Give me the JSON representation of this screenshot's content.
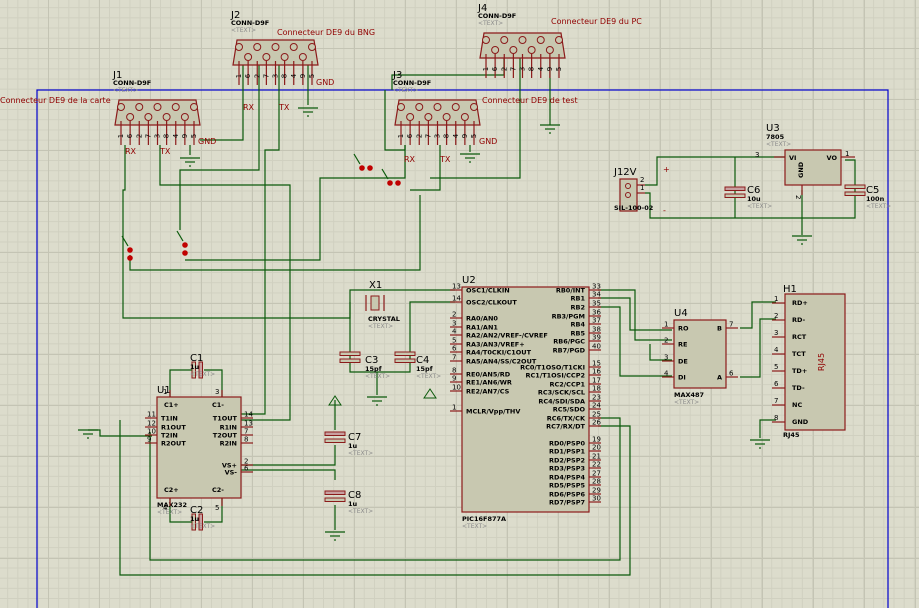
{
  "colors": {
    "wire": "#0b5a0b",
    "component_border": "#8b1a1a",
    "component_fill": "#c8c8b0",
    "sheet_border": "#0000cc",
    "label": "#900000",
    "background": "#dcdccc"
  },
  "placeholder": "<TEXT>",
  "connectors": {
    "J1": {
      "ref": "J1",
      "value": "CONN-D9F",
      "label": "Connecteur DE9 de la carte",
      "rx": "RX",
      "tx": "TX",
      "gnd": "GND"
    },
    "J2": {
      "ref": "J2",
      "value": "CONN-D9F",
      "label": "Connecteur DE9 du BNG",
      "rx": "RX",
      "tx": "TX",
      "gnd": "GND"
    },
    "J3": {
      "ref": "J3",
      "value": "CONN-D9F",
      "label": "Connecteur DE9 de test",
      "rx": "RX",
      "tx": "TX",
      "gnd": "GND"
    },
    "J4": {
      "ref": "J4",
      "value": "CONN-D9F",
      "label": "Connecteur DE9 du PC"
    },
    "db9_pins": [
      "1",
      "6",
      "2",
      "7",
      "3",
      "8",
      "4",
      "9",
      "5"
    ]
  },
  "power": {
    "ref": "J12V",
    "value": "SIL-100-02",
    "pins": [
      "2",
      "1"
    ],
    "plus": "+",
    "minus": "-"
  },
  "U3": {
    "ref": "U3",
    "value": "7805",
    "vi": "VI",
    "vo": "VO",
    "gnd": "GND",
    "pin_vi": "3",
    "pin_vo": "1",
    "pin_gnd": "2"
  },
  "caps": [
    {
      "ref": "C1",
      "value": "1u"
    },
    {
      "ref": "C2",
      "value": "1u"
    },
    {
      "ref": "C3",
      "value": "15pf"
    },
    {
      "ref": "C4",
      "value": "15pf"
    },
    {
      "ref": "C5",
      "value": "100n"
    },
    {
      "ref": "C6",
      "value": "10u"
    },
    {
      "ref": "C7",
      "value": "1u"
    },
    {
      "ref": "C8",
      "value": "1u"
    }
  ],
  "X1": {
    "ref": "X1",
    "value": "CRYSTAL"
  },
  "U1": {
    "ref": "U1",
    "value": "MAX232",
    "left": [
      {
        "n": "11",
        "l": "T1IN"
      },
      {
        "n": "12",
        "l": "R1OUT"
      },
      {
        "n": "10",
        "l": "T2IN"
      },
      {
        "n": "9",
        "l": "R2OUT"
      }
    ],
    "right": [
      {
        "n": "14",
        "l": "T1OUT"
      },
      {
        "n": "13",
        "l": "R1IN"
      },
      {
        "n": "7",
        "l": "T2OUT"
      },
      {
        "n": "8",
        "l": "R2IN"
      },
      {
        "n": "2",
        "l": "VS+"
      },
      {
        "n": "6",
        "l": "VS-"
      }
    ],
    "top": [
      {
        "n": "1",
        "l": "C1+"
      },
      {
        "n": "3",
        "l": "C1-"
      }
    ],
    "bottom": [
      {
        "n": "4",
        "l": "C2+"
      },
      {
        "n": "5",
        "l": "C2-"
      }
    ]
  },
  "U2": {
    "ref": "U2",
    "value": "PIC16F877A",
    "left": [
      {
        "n": "13",
        "l": "OSC1/CLKIN"
      },
      {
        "n": "14",
        "l": "OSC2/CLKOUT"
      },
      {
        "n": "2",
        "l": "RA0/AN0"
      },
      {
        "n": "3",
        "l": "RA1/AN1"
      },
      {
        "n": "4",
        "l": "RA2/AN2/VREF-/CVREF"
      },
      {
        "n": "5",
        "l": "RA3/AN3/VREF+"
      },
      {
        "n": "6",
        "l": "RA4/T0CKI/C1OUT"
      },
      {
        "n": "7",
        "l": "RA5/AN4/SS/C2OUT"
      },
      {
        "n": "8",
        "l": "RE0/AN5/RD"
      },
      {
        "n": "9",
        "l": "RE1/AN6/WR"
      },
      {
        "n": "10",
        "l": "RE2/AN7/CS"
      },
      {
        "n": "1",
        "l": "MCLR/Vpp/THV"
      }
    ],
    "right": [
      {
        "n": "33",
        "l": "RB0/INT"
      },
      {
        "n": "34",
        "l": "RB1"
      },
      {
        "n": "35",
        "l": "RB2"
      },
      {
        "n": "36",
        "l": "RB3/PGM"
      },
      {
        "n": "37",
        "l": "RB4"
      },
      {
        "n": "38",
        "l": "RB5"
      },
      {
        "n": "39",
        "l": "RB6/PGC"
      },
      {
        "n": "40",
        "l": "RB7/PGD"
      },
      {
        "n": "15",
        "l": "RC0/T1OSO/T1CKI"
      },
      {
        "n": "16",
        "l": "RC1/T1OSI/CCP2"
      },
      {
        "n": "17",
        "l": "RC2/CCP1"
      },
      {
        "n": "18",
        "l": "RC3/SCK/SCL"
      },
      {
        "n": "23",
        "l": "RC4/SDI/SDA"
      },
      {
        "n": "24",
        "l": "RC5/SDO"
      },
      {
        "n": "25",
        "l": "RC6/TX/CK"
      },
      {
        "n": "26",
        "l": "RC7/RX/DT"
      },
      {
        "n": "19",
        "l": "RD0/PSP0"
      },
      {
        "n": "20",
        "l": "RD1/PSP1"
      },
      {
        "n": "21",
        "l": "RD2/PSP2"
      },
      {
        "n": "22",
        "l": "RD3/PSP3"
      },
      {
        "n": "27",
        "l": "RD4/PSP4"
      },
      {
        "n": "28",
        "l": "RD5/PSP5"
      },
      {
        "n": "29",
        "l": "RD6/PSP6"
      },
      {
        "n": "30",
        "l": "RD7/PSP7"
      }
    ]
  },
  "U4": {
    "ref": "U4",
    "value": "MAX487",
    "left": [
      {
        "n": "1",
        "l": "RO"
      },
      {
        "n": "2",
        "l": "RE"
      },
      {
        "n": "3",
        "l": "DE"
      },
      {
        "n": "4",
        "l": "DI"
      }
    ],
    "right": [
      {
        "n": "7",
        "l": "B"
      },
      {
        "n": "6",
        "l": "A"
      }
    ]
  },
  "H1": {
    "ref": "H1",
    "value": "RJ45",
    "body_label": "RJ45",
    "pins": [
      {
        "n": "1",
        "l": "RD+"
      },
      {
        "n": "2",
        "l": "RD-"
      },
      {
        "n": "3",
        "l": "RCT"
      },
      {
        "n": "4",
        "l": "TCT"
      },
      {
        "n": "5",
        "l": "TD+"
      },
      {
        "n": "6",
        "l": "TD-"
      },
      {
        "n": "7",
        "l": "NC"
      },
      {
        "n": "8",
        "l": "GND"
      }
    ]
  }
}
